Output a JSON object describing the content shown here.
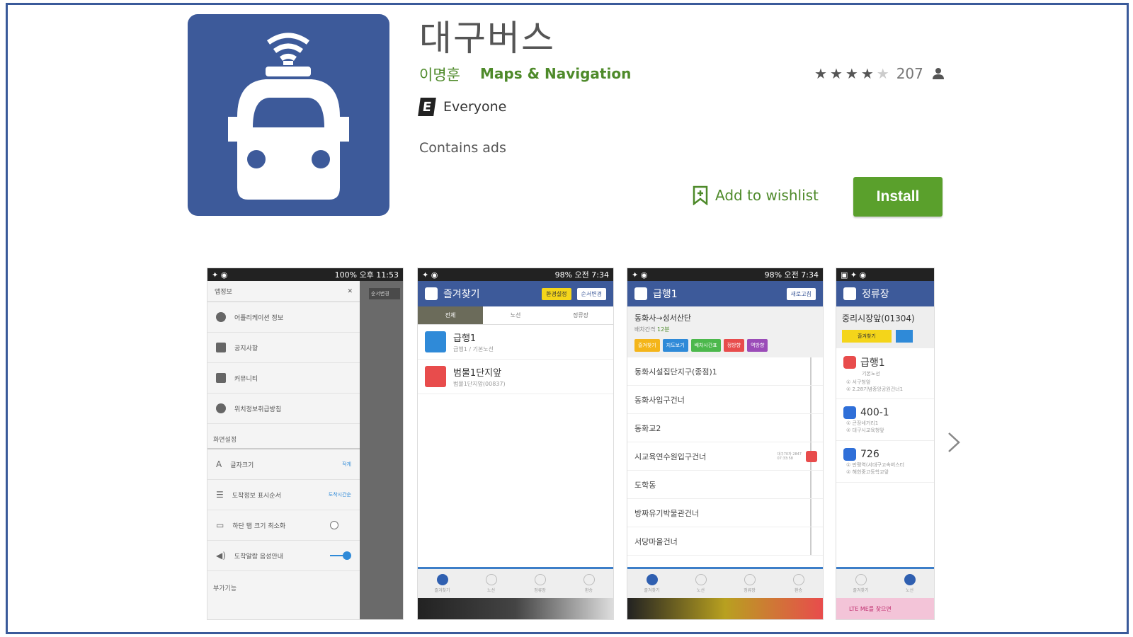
{
  "app": {
    "title": "대구버스",
    "developer": "이명훈",
    "category": "Maps & Navigation",
    "rating_count": "207",
    "stars_filled": 4,
    "stars_total": 5,
    "content_rating": "Everyone",
    "content_rating_badge": "E",
    "ads_notice": "Contains ads",
    "wishlist_label": "Add to wishlist",
    "install_label": "Install",
    "icon_color": "#3d5a9a",
    "accent_green": "#5aa02c"
  },
  "screenshots": [
    {
      "status_time": "오후 11:53",
      "status_battery": "100%",
      "drawer_title": "앱정보",
      "items": [
        {
          "label": "어플리케이션 정보"
        },
        {
          "label": "공지사항"
        },
        {
          "label": "커뮤니티"
        },
        {
          "label": "위치정보취급방침"
        }
      ],
      "section_display": "화면설정",
      "settings": [
        {
          "label": "글자크기",
          "value": "작게"
        },
        {
          "label": "도착정보 표시순서",
          "value": "도착시간순"
        },
        {
          "label": "하단 탭 크기 최소화",
          "value": ""
        },
        {
          "label": "도착알람 음성안내",
          "value": ""
        }
      ],
      "section_extra": "부가기능",
      "bg_button": "순서변경"
    },
    {
      "status_time": "오전 7:34",
      "status_battery": "98%",
      "appbar_title": "즐겨찾기",
      "chip_yellow": "환경설정",
      "chip_white": "순서변경",
      "tabs": [
        "전체",
        "노선",
        "정류장"
      ],
      "items": [
        {
          "title": "급행1",
          "sub": "급행1 / 기본노선"
        },
        {
          "title": "범물1단지앞",
          "sub": "범물1단지앞(00837)"
        }
      ],
      "nav": [
        "즐겨찾기",
        "노선",
        "정류장",
        "환승"
      ]
    },
    {
      "status_time": "오전 7:34",
      "status_battery": "98%",
      "appbar_title": "급행1",
      "chip_white": "새로고침",
      "route_name": "동화사→성서산단",
      "interval_label": "배차간격",
      "interval_value": "12분",
      "buttons": [
        "즐겨찾기",
        "지도보기",
        "배차시간표",
        "정방향",
        "역방향"
      ],
      "stops": [
        "동화시설집단지구(종점)1",
        "동화사입구건너",
        "동화교2",
        "시교육연수원입구건너",
        "도학동",
        "방짜유기박물관건너",
        "서당마을건너"
      ],
      "bus_eta": "대구70자 2847",
      "bus_eta_time": "07:33:58",
      "nav": [
        "즐겨찾기",
        "노선",
        "정류장",
        "환승"
      ]
    },
    {
      "appbar_title": "정류장",
      "stop_name": "중리시장앞(01304)",
      "fav_button": "즐겨찾기",
      "buses": [
        {
          "number": "급행1",
          "type": "기본노선",
          "line1": "① 서구청앞",
          "line2": "② 2.28기념중앙공원건너1"
        },
        {
          "number": "400-1",
          "type": "",
          "line1": "① 큰장네거리1",
          "line2": "② 대구시교육청앞"
        },
        {
          "number": "726",
          "type": "",
          "line1": "① 만평역(서대구고속버스터",
          "line2": "② 해헌중고등학교앞"
        }
      ],
      "nav": [
        "즐겨찾기",
        "노선"
      ],
      "ad_text": "LTE ME를 찾으면"
    }
  ]
}
